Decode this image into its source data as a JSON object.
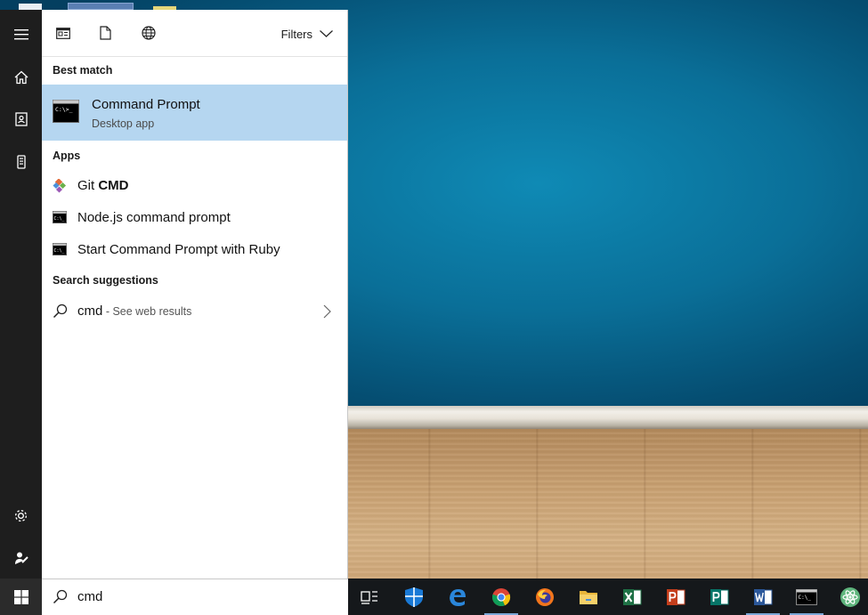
{
  "panel": {
    "scopes": [
      {
        "name": "apps-scope-icon"
      },
      {
        "name": "documents-scope-icon"
      },
      {
        "name": "web-scope-icon"
      }
    ],
    "filters_label": "Filters",
    "best_match_header": "Best match",
    "best_match": {
      "title": "Command Prompt",
      "subtitle": "Desktop app",
      "icon": "command-prompt-icon"
    },
    "apps_header": "Apps",
    "apps": [
      {
        "prefix": "Git ",
        "bold": "CMD",
        "icon": "git-icon"
      },
      {
        "prefix": "Node.js command prompt",
        "bold": "",
        "icon": "console-icon"
      },
      {
        "prefix": "Start Command Prompt with Ruby",
        "bold": "",
        "icon": "console-icon"
      }
    ],
    "suggestions_header": "Search suggestions",
    "suggestion": {
      "query": "cmd",
      "hint": " - See web results"
    }
  },
  "rail": {
    "items": [
      "menu-icon",
      "home-icon",
      "notebook-icon",
      "device-icon",
      "settings-icon",
      "feedback-icon"
    ]
  },
  "taskbar": {
    "search_value": "cmd",
    "apps": [
      "task-view-icon",
      "security-shield-icon",
      "edge-icon",
      "chrome-icon",
      "firefox-icon",
      "file-explorer-icon",
      "excel-icon",
      "powerpoint-icon",
      "publisher-icon",
      "word-icon",
      "terminal-icon",
      "atom-icon"
    ],
    "colors": {
      "highlight": "#b5d6f0",
      "rail": "#1e1e1e",
      "taskbar": "#15181b"
    }
  }
}
